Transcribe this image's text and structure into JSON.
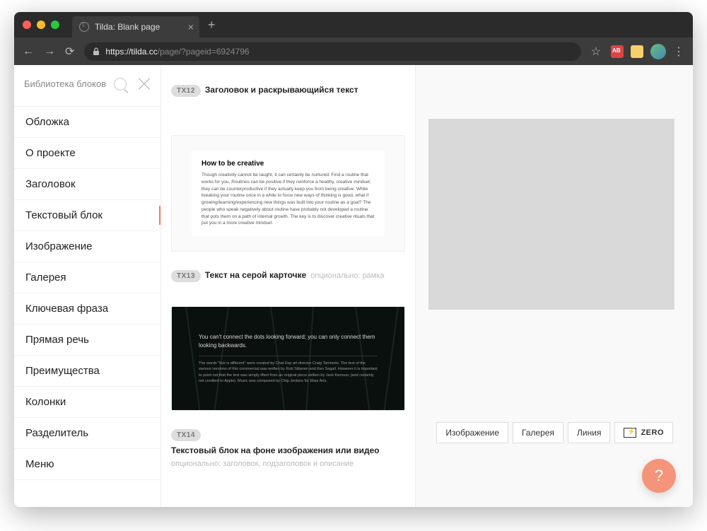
{
  "browser": {
    "tab_title": "Tilda: Blank page",
    "url_host": "https://tilda.cc",
    "url_path": "/page/?pageid=6924796"
  },
  "sidebar": {
    "title": "Библиотека блоков",
    "categories": [
      "Обложка",
      "О проекте",
      "Заголовок",
      "Текстовый блок",
      "Изображение",
      "Галерея",
      "Ключевая фраза",
      "Прямая речь",
      "Преимущества",
      "Колонки",
      "Разделитель",
      "Меню"
    ],
    "active_index": 3
  },
  "blocks": [
    {
      "code": "TX12",
      "title": "Заголовок и раскрывающийся текст",
      "optional": ""
    },
    {
      "code": "TX13",
      "title": "Текст на серой карточке",
      "optional": "опционально: рамка",
      "preview": {
        "heading": "How to be creative",
        "body": "Though creativity cannot be taught, it can certainly be nurtured. Find a routine that works for you. Routines can be positive if they reinforce a healthy, creative mindset; they can be counterproductive if they actually keep you from being creative. While breaking your routine once in a while to force new ways of thinking is good, what if growing/learning/experiencing new things was built into your routine as a goal? The people who speak negatively about routine have probably not developed a routine that puts them on a path of internal growth. The key is to discover creative rituals that put you in a more creative mindset."
      }
    },
    {
      "code": "TX14",
      "title": "Текстовый блок на фоне изображения или видео",
      "optional": "опционально: заголовок, подзаголовок и описание",
      "preview": {
        "quote": "You can't connect the dots looking forward; you can only connect them looking backwards.",
        "sub": "The words \"this is different\" were created by Chat Day art director Craig Tanimoto. The text of the various versions of this commercial was written by Rob Siltanen and Ken Segall. However it is important to point out that the text was simply lifted from an original piece written by Jack Kerouac (and certainly not credited to Apple). Music was composed by Chip Jenkins for Elias Arts."
      }
    }
  ],
  "toolbar": {
    "items": [
      "Изображение",
      "Галерея",
      "Линия"
    ],
    "zero": "ZERO"
  },
  "help": "?"
}
